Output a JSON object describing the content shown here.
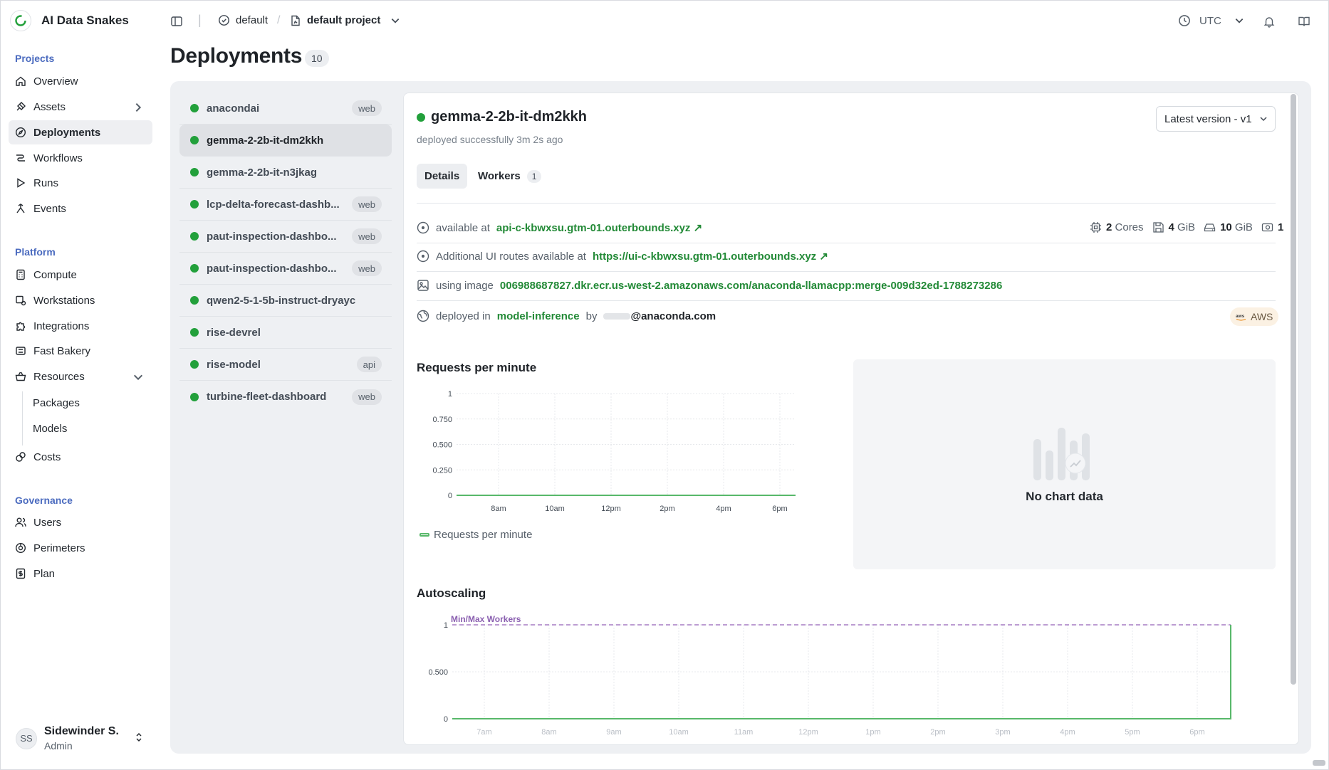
{
  "app": {
    "name": "AI Data Snakes"
  },
  "sidebar": {
    "projects_title": "Projects",
    "projects_items": [
      {
        "label": "Overview"
      },
      {
        "label": "Assets"
      },
      {
        "label": "Deployments"
      },
      {
        "label": "Workflows"
      },
      {
        "label": "Runs"
      },
      {
        "label": "Events"
      }
    ],
    "platform_title": "Platform",
    "platform_items": [
      {
        "label": "Compute"
      },
      {
        "label": "Workstations"
      },
      {
        "label": "Integrations"
      },
      {
        "label": "Fast Bakery"
      },
      {
        "label": "Resources"
      }
    ],
    "resources_sub": [
      {
        "label": "Packages"
      },
      {
        "label": "Models"
      }
    ],
    "costs_label": "Costs",
    "governance_title": "Governance",
    "governance_items": [
      {
        "label": "Users"
      },
      {
        "label": "Perimeters"
      },
      {
        "label": "Plan"
      }
    ],
    "user": {
      "initials": "SS",
      "name": "Sidewinder S.",
      "role": "Admin"
    }
  },
  "topbar": {
    "perimeter": "default",
    "separator": "/",
    "project": "default project",
    "timezone": "UTC"
  },
  "page": {
    "title": "Deployments",
    "count": "10"
  },
  "deployments": [
    {
      "name": "anacondai",
      "tag": "web"
    },
    {
      "name": "gemma-2-2b-it-dm2kkh",
      "tag": ""
    },
    {
      "name": "gemma-2-2b-it-n3jkag",
      "tag": ""
    },
    {
      "name": "lcp-delta-forecast-dashb...",
      "tag": "web"
    },
    {
      "name": "paut-inspection-dashbo...",
      "tag": "web"
    },
    {
      "name": "paut-inspection-dashbo...",
      "tag": "web"
    },
    {
      "name": "qwen2-5-1-5b-instruct-dryayc",
      "tag": ""
    },
    {
      "name": "rise-devrel",
      "tag": ""
    },
    {
      "name": "rise-model",
      "tag": "api"
    },
    {
      "name": "turbine-fleet-dashboard",
      "tag": "web"
    }
  ],
  "detail": {
    "name": "gemma-2-2b-it-dm2kkh",
    "status_text": "deployed successfully 3m 2s ago",
    "version_label": "Latest version - v1",
    "tabs": [
      {
        "label": "Details"
      },
      {
        "label": "Workers",
        "count": "1"
      }
    ],
    "available_prefix": "available at",
    "available_url": "api-c-kbwxsu.gtm-01.outerbounds.xyz",
    "routes_prefix": "Additional UI routes available at",
    "routes_url": "https://ui-c-kbwxsu.gtm-01.outerbounds.xyz",
    "image_prefix": "using image",
    "image": "006988687827.dkr.ecr.us-west-2.amazonaws.com/anaconda-llamacpp:merge-009d32ed-1788273286",
    "deployed_in_prefix": "deployed in",
    "deployed_in": "model-inference",
    "by_text": "by",
    "user_domain": "@anaconda.com",
    "cloud": "AWS",
    "resources": {
      "cores": "2",
      "cores_label": "Cores",
      "memory": "4",
      "memory_unit": "GiB",
      "disk": "10",
      "disk_unit": "GiB",
      "gpu": "1"
    }
  },
  "empty_chart": {
    "text": "No chart data"
  },
  "colors": {
    "accent_green": "#22a03b",
    "link_green": "#238a37",
    "autoscale_purple": "#8a5fb0"
  },
  "chart_data": [
    {
      "type": "line",
      "title": "Requests per minute",
      "x": [
        "8am",
        "10am",
        "12pm",
        "2pm",
        "4pm",
        "6pm"
      ],
      "y_ticks": [
        "1",
        "0.750",
        "0.500",
        "0.250",
        "0"
      ],
      "ylim": [
        0,
        1
      ],
      "series": [
        {
          "name": "Requests per minute",
          "values": [
            0,
            0,
            0,
            0,
            0,
            0
          ]
        }
      ],
      "grid": true,
      "legend": "bottom-left"
    },
    {
      "type": "line",
      "title": "Autoscaling",
      "x": [
        "7am",
        "8am",
        "9am",
        "10am",
        "11am",
        "12pm",
        "1pm",
        "2pm",
        "3pm",
        "4pm",
        "5pm",
        "6pm"
      ],
      "y_ticks": [
        "1",
        "0.500",
        "0"
      ],
      "ylim": [
        0,
        1
      ],
      "series": [
        {
          "name": "Min/Max Workers",
          "values": [
            1,
            1,
            1,
            1,
            1,
            1,
            1,
            1,
            1,
            1,
            1,
            1
          ],
          "style": "dashed"
        },
        {
          "values": [
            0,
            0,
            0,
            0,
            0,
            0,
            0,
            0,
            0,
            0,
            0,
            1
          ]
        }
      ],
      "grid": true
    }
  ]
}
